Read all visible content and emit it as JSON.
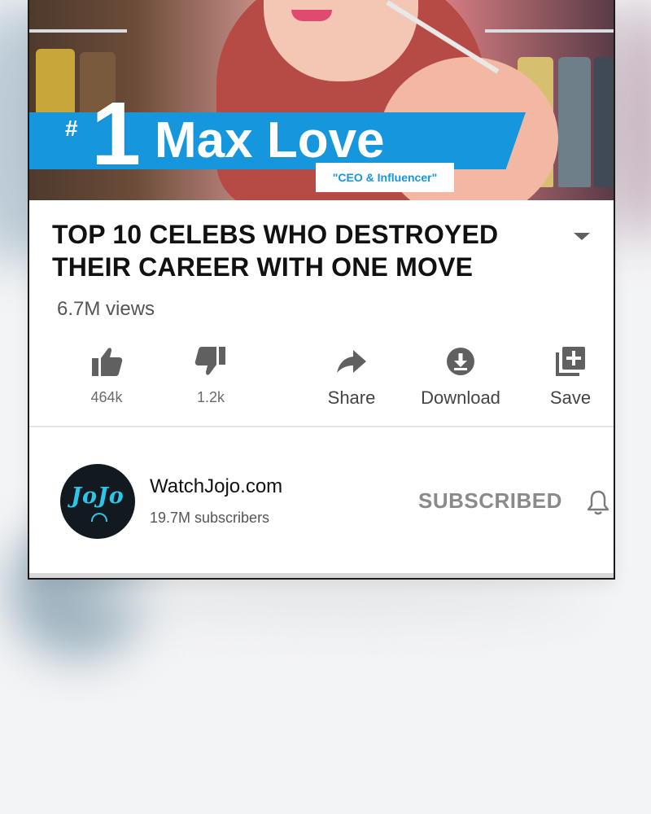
{
  "thumbnail": {
    "rank_hash": "#",
    "rank_number": "1",
    "name": "Max Love",
    "subtitle": "\"CEO & Influencer\""
  },
  "video": {
    "title": "TOP 10 CELEBS WHO DESTROYED THEIR CAREER WITH ONE MOVE",
    "views": "6.7M views"
  },
  "actions": {
    "like": {
      "label": "464k",
      "icon": "thumbs-up-icon"
    },
    "dislike": {
      "label": "1.2k",
      "icon": "thumbs-down-icon"
    },
    "share": {
      "label": "Share",
      "icon": "share-arrow-icon"
    },
    "download": {
      "label": "Download",
      "icon": "download-icon"
    },
    "save": {
      "label": "Save",
      "icon": "playlist-add-icon"
    }
  },
  "channel": {
    "avatar_text": "JoJo",
    "name": "WatchJojo.com",
    "subscribers": "19.7M subscribers",
    "subscribe_state": "SUBSCRIBED",
    "bell_icon": "bell-icon"
  },
  "colors": {
    "banner_blue": "#1596dd",
    "avatar_accent": "#2cc6e8",
    "icon_gray": "#606060"
  }
}
